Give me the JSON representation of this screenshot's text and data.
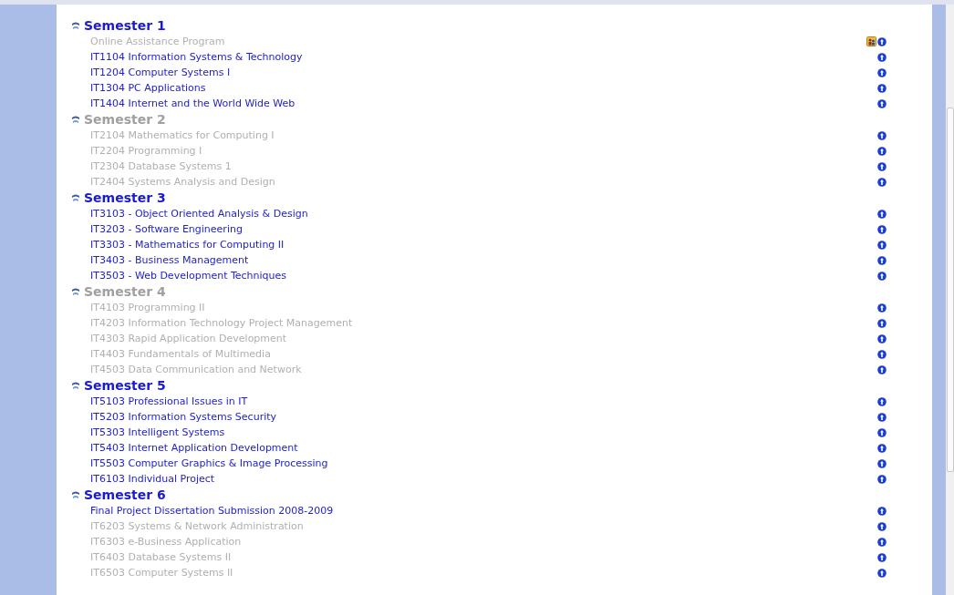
{
  "semesters": [
    {
      "title": "Semester 1",
      "disabled": false,
      "courses": [
        {
          "name": "Online Assistance Program",
          "disabled": true,
          "assist_icon": true
        },
        {
          "name": "IT1104 Information Systems & Technology",
          "disabled": false
        },
        {
          "name": "IT1204 Computer Systems I",
          "disabled": false
        },
        {
          "name": "IT1304 PC Applications",
          "disabled": false
        },
        {
          "name": "IT1404 Internet and the World Wide Web",
          "disabled": false
        }
      ]
    },
    {
      "title": "Semester 2",
      "disabled": true,
      "courses": [
        {
          "name": "IT2104 Mathematics for Computing I",
          "disabled": true
        },
        {
          "name": "IT2204 Programming I",
          "disabled": true
        },
        {
          "name": "IT2304 Database Systems 1",
          "disabled": true
        },
        {
          "name": "IT2404 Systems Analysis and Design",
          "disabled": true
        }
      ]
    },
    {
      "title": "Semester 3",
      "disabled": false,
      "courses": [
        {
          "name": "IT3103 - Object Oriented Analysis & Design",
          "disabled": false
        },
        {
          "name": "IT3203 - Software Engineering",
          "disabled": false
        },
        {
          "name": "IT3303 - Mathematics for Computing II",
          "disabled": false
        },
        {
          "name": "IT3403 - Business Management",
          "disabled": false
        },
        {
          "name": "IT3503 - Web Development Techniques",
          "disabled": false
        }
      ]
    },
    {
      "title": "Semester 4",
      "disabled": true,
      "courses": [
        {
          "name": "IT4103 Programming II",
          "disabled": true
        },
        {
          "name": "IT4203 Information Technology Project Management",
          "disabled": true
        },
        {
          "name": "IT4303 Rapid Application Development",
          "disabled": true
        },
        {
          "name": "IT4403 Fundamentals of Multimedia",
          "disabled": true
        },
        {
          "name": "IT4503 Data Communication and Network",
          "disabled": true
        }
      ]
    },
    {
      "title": "Semester 5",
      "disabled": false,
      "courses": [
        {
          "name": "IT5103 Professional Issues in IT",
          "disabled": false
        },
        {
          "name": "IT5203 Information Systems Security",
          "disabled": false
        },
        {
          "name": "IT5303 Intelligent Systems",
          "disabled": false
        },
        {
          "name": "IT5403 Internet Application Development",
          "disabled": false
        },
        {
          "name": "IT5503 Computer Graphics & Image Processing",
          "disabled": false
        },
        {
          "name": "IT6103 Individual Project",
          "disabled": false
        }
      ]
    },
    {
      "title": "Semester 6",
      "disabled": false,
      "courses": [
        {
          "name": "Final Project Dissertation Submission 2008-2009",
          "disabled": false
        },
        {
          "name": "IT6203 Systems & Network Administration",
          "disabled": true
        },
        {
          "name": "IT6303 e-Business Application",
          "disabled": true
        },
        {
          "name": "IT6403 Database Systems II",
          "disabled": true
        },
        {
          "name": "IT6503 Computer Systems II",
          "disabled": true
        }
      ]
    }
  ]
}
